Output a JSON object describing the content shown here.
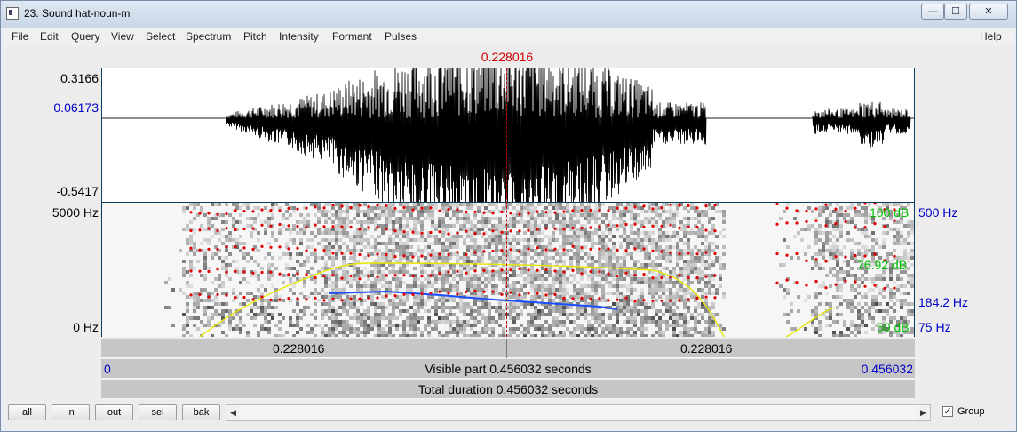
{
  "window": {
    "title": "23. Sound hat-noun-m",
    "minimize": "—",
    "maximize": "☐",
    "close": "✕"
  },
  "menu": [
    "File",
    "Edit",
    "Query",
    "View",
    "Select",
    "Spectrum",
    "Pitch",
    "Intensity",
    "Formant",
    "Pulses"
  ],
  "help": "Help",
  "cursor_time": "0.228016",
  "waveform": {
    "y_top": "0.3166",
    "y_cursor": "0.06173",
    "y_bottom": "-0.5417"
  },
  "spectrogram": {
    "freq_top": "5000 Hz",
    "freq_bottom": "0 Hz",
    "intensity_top": "100 dB",
    "intensity_cursor": "76.92 dB",
    "intensity_bottom": "50 dB",
    "pitch_top": "500 Hz",
    "pitch_cursor": "184.2 Hz",
    "pitch_bottom": "75 Hz"
  },
  "time_bar": {
    "left": "0.228016",
    "right": "0.228016"
  },
  "visible_bar": {
    "start": "0",
    "label": "Visible part 0.456032 seconds",
    "end": "0.456032"
  },
  "total_bar": {
    "label": "Total duration 0.456032 seconds"
  },
  "nav_buttons": [
    "all",
    "in",
    "out",
    "sel",
    "bak"
  ],
  "group": {
    "label": "Group",
    "checked": "✓"
  },
  "colors": {
    "cursor": "#d00000",
    "pitch_label": "#0000c8",
    "intensity_label": "#00c000",
    "formant": "#e00000",
    "pitch_line": "#1a4fff",
    "intensity_line": "#e6e600"
  }
}
